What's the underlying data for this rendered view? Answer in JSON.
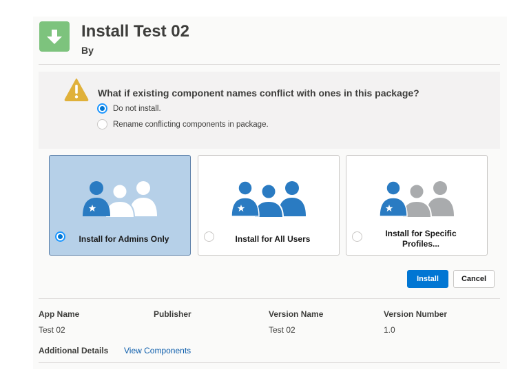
{
  "header": {
    "title": "Install Test 02",
    "subtitle": "By",
    "icon": "download-arrow-icon",
    "icon_color": "#7dc37d"
  },
  "conflict": {
    "icon": "warning-icon",
    "question": "What if existing component names conflict with ones in this package?",
    "options": [
      {
        "label": "Do not install.",
        "selected": true
      },
      {
        "label": "Rename conflicting components in package.",
        "selected": false
      }
    ]
  },
  "install_options": [
    {
      "label": "Install for Admins Only",
      "selected": true
    },
    {
      "label": "Install for All Users",
      "selected": false
    },
    {
      "label": "Install for Specific Profiles...",
      "selected": false
    }
  ],
  "actions": {
    "install_label": "Install",
    "cancel_label": "Cancel"
  },
  "package_info": {
    "app_name_label": "App Name",
    "app_name_value": "Test 02",
    "publisher_label": "Publisher",
    "publisher_value": "",
    "version_name_label": "Version Name",
    "version_name_value": "Test 02",
    "version_number_label": "Version Number",
    "version_number_value": "1.0"
  },
  "details": {
    "label": "Additional Details",
    "link": "View Components"
  },
  "colors": {
    "accent": "#0176d3",
    "selected_card": "#b6d0e8",
    "admin_person": "#2a7bc2",
    "inactive_person": "#a9abad"
  }
}
